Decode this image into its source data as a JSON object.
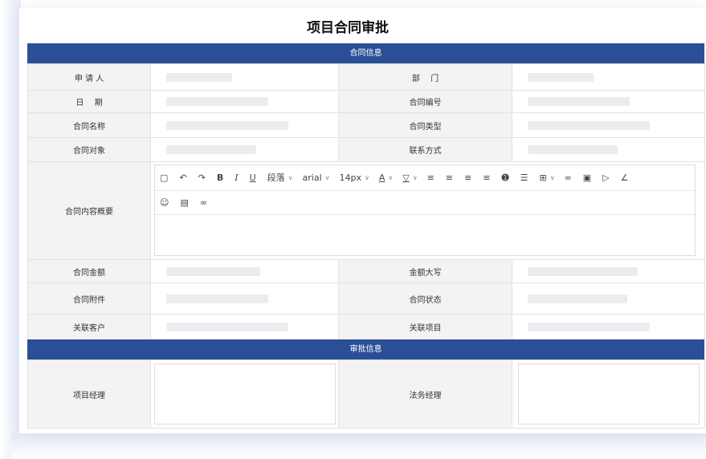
{
  "title": "项目合同审批",
  "sections": {
    "contract_info": "合同信息",
    "approval_info": "审批信息"
  },
  "labels": {
    "applicant": "申 请 人",
    "department": "部　 门",
    "date": "日　 期",
    "contract_no": "合同编号",
    "contract_name": "合同名称",
    "contract_type": "合同类型",
    "contract_party": "合同对象",
    "contact": "联系方式",
    "summary": "合同内容概要",
    "amount": "合同金额",
    "amount_caps": "金额大写",
    "attachment": "合同附件",
    "status": "合同状态",
    "customer": "关联客户",
    "project": "关联项目",
    "project_manager": "项目经理",
    "legal_manager": "法务经理"
  },
  "toolbar": {
    "paragraph": "段落",
    "font": "arial",
    "size": "14px",
    "bold": "B",
    "italic": "I",
    "underline": "U",
    "font_color": "A"
  }
}
